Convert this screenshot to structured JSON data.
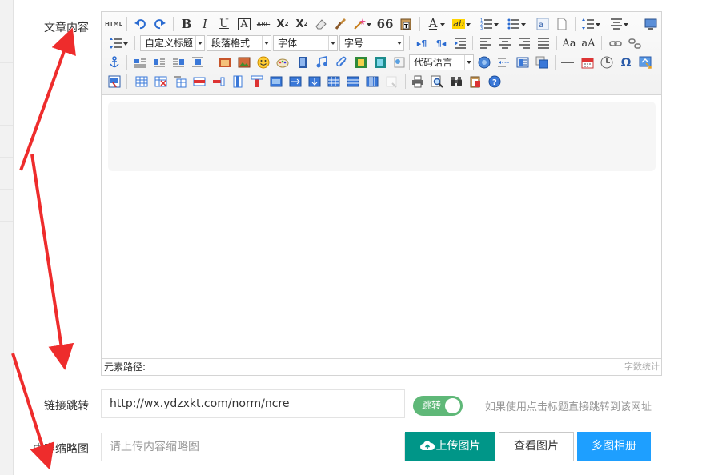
{
  "labels": {
    "article_content": "文章内容",
    "jump_link": "链接跳转",
    "thumbnail": "内容缩略图"
  },
  "editor": {
    "toolbar": {
      "html_label": "HTML",
      "bold": "B",
      "italic": "I",
      "underline": "U",
      "font_border": "A",
      "strikethrough": "ABC",
      "superscript": "X",
      "subscript": "X",
      "quote": "66",
      "font_color": "A",
      "highlight": "ab",
      "custom_title": "自定义标题",
      "paragraph_format": "段落格式",
      "font_family": "字体",
      "font_size": "字号",
      "code_language": "代码语言",
      "special_char": "Ω",
      "help": "?"
    },
    "element_path": "元素路径:",
    "word_count": "字数统计"
  },
  "jump": {
    "url_value": "http://wx.ydzxkt.com/norm/ncre",
    "toggle_label": "跳转",
    "hint": "如果使用点击标题直接跳转到该网址"
  },
  "thumbnail": {
    "placeholder": "请上传内容缩略图",
    "upload_button": "上传图片",
    "view_button": "查看图片",
    "album_button": "多图相册"
  },
  "colors": {
    "toggle_on": "#5fb878",
    "upload_button": "#009688",
    "album_button": "#1e9fff",
    "annotation_arrow": "#ee2c2c"
  }
}
